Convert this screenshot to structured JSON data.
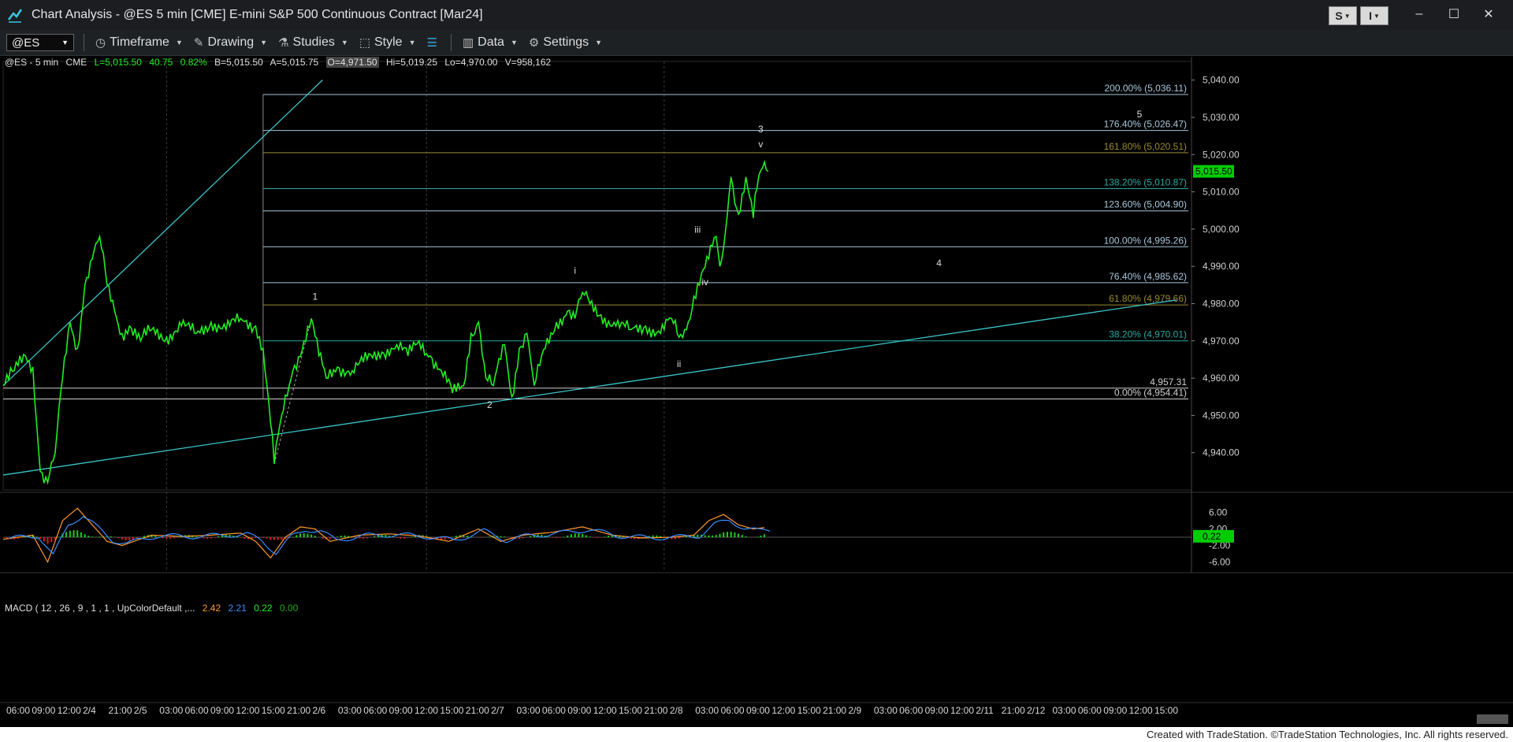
{
  "window": {
    "title": "Chart Analysis - @ES 5 min [CME] E-mini S&P 500 Continuous Contract [Mar24]",
    "s_button": "S",
    "i_button": "I",
    "minimize": "–",
    "maximize": "☐",
    "close": "✕"
  },
  "toolbar": {
    "symbol": "@ES",
    "items": [
      "Timeframe",
      "Drawing",
      "Studies",
      "Style",
      "Data",
      "Settings"
    ]
  },
  "quote": {
    "symbol": "@ES - 5 min",
    "exchange": "CME",
    "last": "L=5,015.50",
    "change": "40.75",
    "pct": "0.82%",
    "bid": "B=5,015.50",
    "ask": "A=5,015.75",
    "open": "O=4,971.50",
    "high": "Hi=5,019.25",
    "low": "Lo=4,970.00",
    "volume": "V=958,162"
  },
  "macd": {
    "label": "MACD ( 12 , 26 , 9 , 1 , 1 , UpColorDefault ,...",
    "v1": "2.42",
    "v2": "2.21",
    "v3": "0.22",
    "v4": "0.00"
  },
  "footer": "Created with TradeStation. ©TradeStation Technologies, Inc. All rights reserved.",
  "colors": {
    "price": "#22ee22",
    "trendline": "#3bc4c8",
    "fib_blue": "#a9c7db",
    "fib_gold": "#9a8a30",
    "fib_teal": "#2aa7a0",
    "macd_up": "#19d019",
    "macd_down": "#e01a1a",
    "last_price_bg": "#00cc00"
  },
  "chart_data": {
    "type": "line",
    "y_range": [
      4930,
      5045
    ],
    "y_ticks": [
      "5,040.00",
      "5,030.00",
      "5,020.00",
      "5,010.00",
      "5,000.00",
      "4,990.00",
      "4,980.00",
      "4,970.00",
      "4,960.00",
      "4,950.00",
      "4,940.00"
    ],
    "y_tick_values": [
      5040,
      5030,
      5020,
      5010,
      5000,
      4990,
      4980,
      4970,
      4960,
      4950,
      4940
    ],
    "last_price_label": "5,015.50",
    "last_price": 5015.5,
    "x_tick_labels": [
      "06:00",
      "09:00",
      "12:00",
      "2/4",
      "21:00",
      "2/5",
      "03:00",
      "06:00",
      "09:00",
      "12:00",
      "15:00",
      "21:00",
      "2/6",
      "03:00",
      "06:00",
      "09:00",
      "12:00",
      "15:00",
      "21:00",
      "2/7",
      "03:00",
      "06:00",
      "09:00",
      "12:00",
      "15:00",
      "21:00",
      "2/8",
      "03:00",
      "06:00",
      "09:00",
      "12:00",
      "15:00",
      "21:00",
      "2/9",
      "03:00",
      "06:00",
      "09:00",
      "12:00",
      "2/11",
      "21:00",
      "2/12",
      "03:00",
      "06:00",
      "09:00",
      "12:00",
      "15:00"
    ],
    "price_series": [
      [
        0,
        4958
      ],
      [
        3,
        4962
      ],
      [
        6,
        4966
      ],
      [
        8,
        4963
      ],
      [
        10,
        4935
      ],
      [
        12,
        4932
      ],
      [
        14,
        4940
      ],
      [
        16,
        4960
      ],
      [
        18,
        4975
      ],
      [
        20,
        4968
      ],
      [
        22,
        4985
      ],
      [
        24,
        4992
      ],
      [
        26,
        4998
      ],
      [
        28,
        4985
      ],
      [
        30,
        4978
      ],
      [
        32,
        4972
      ],
      [
        34,
        4974
      ],
      [
        37,
        4970
      ],
      [
        40,
        4973
      ],
      [
        44,
        4971
      ],
      [
        48,
        4974
      ],
      [
        52,
        4972
      ],
      [
        56,
        4975
      ],
      [
        60,
        4973
      ],
      [
        64,
        4976
      ],
      [
        68,
        4974
      ],
      [
        70,
        4968
      ],
      [
        72,
        4948
      ],
      [
        73,
        4937
      ],
      [
        75,
        4950
      ],
      [
        78,
        4962
      ],
      [
        81,
        4970
      ],
      [
        83,
        4976
      ],
      [
        85,
        4966
      ],
      [
        87,
        4960
      ],
      [
        90,
        4963
      ],
      [
        94,
        4962
      ],
      [
        98,
        4965
      ],
      [
        102,
        4967
      ],
      [
        106,
        4969
      ],
      [
        109,
        4966
      ],
      [
        112,
        4970
      ],
      [
        115,
        4966
      ],
      [
        118,
        4962
      ],
      [
        121,
        4956
      ],
      [
        124,
        4958
      ],
      [
        126,
        4972
      ],
      [
        128,
        4975
      ],
      [
        130,
        4960
      ],
      [
        132,
        4958
      ],
      [
        135,
        4969
      ],
      [
        137,
        4955
      ],
      [
        139,
        4968
      ],
      [
        141,
        4972
      ],
      [
        143,
        4958
      ],
      [
        146,
        4968
      ],
      [
        149,
        4975
      ],
      [
        152,
        4978
      ],
      [
        154,
        4976
      ],
      [
        156,
        4983
      ],
      [
        158,
        4980
      ],
      [
        161,
        4977
      ],
      [
        165,
        4974
      ],
      [
        169,
        4973
      ],
      [
        173,
        4974
      ],
      [
        177,
        4972
      ],
      [
        180,
        4976
      ],
      [
        182,
        4971
      ],
      [
        184,
        4973
      ],
      [
        186,
        4982
      ],
      [
        188,
        4988
      ],
      [
        190,
        4992
      ],
      [
        192,
        4998
      ],
      [
        193,
        4990
      ],
      [
        194,
        4995
      ],
      [
        196,
        5014
      ],
      [
        198,
        5004
      ],
      [
        200,
        5014
      ],
      [
        202,
        5003
      ],
      [
        203,
        5011
      ],
      [
        205,
        5018
      ],
      [
        206,
        5015.5
      ]
    ],
    "macd_series": [
      [
        0,
        -0.5
      ],
      [
        8,
        0.5
      ],
      [
        12,
        -6
      ],
      [
        16,
        4
      ],
      [
        20,
        7
      ],
      [
        24,
        3
      ],
      [
        28,
        -1
      ],
      [
        32,
        -2
      ],
      [
        40,
        0.5
      ],
      [
        48,
        0.2
      ],
      [
        56,
        0.5
      ],
      [
        64,
        1
      ],
      [
        68,
        -1
      ],
      [
        72,
        -5
      ],
      [
        76,
        0
      ],
      [
        80,
        2.5
      ],
      [
        84,
        2
      ],
      [
        88,
        -1
      ],
      [
        96,
        0.5
      ],
      [
        104,
        0.8
      ],
      [
        112,
        0.3
      ],
      [
        120,
        -1
      ],
      [
        128,
        2
      ],
      [
        134,
        -1
      ],
      [
        140,
        0.5
      ],
      [
        148,
        1.2
      ],
      [
        156,
        2.5
      ],
      [
        164,
        0.5
      ],
      [
        172,
        -0.2
      ],
      [
        180,
        0
      ],
      [
        186,
        0.5
      ],
      [
        190,
        4
      ],
      [
        194,
        5.5
      ],
      [
        198,
        3
      ],
      [
        202,
        2
      ],
      [
        206,
        2.42
      ]
    ],
    "macd_range": [
      -8,
      8
    ],
    "macd_ticks": [
      "6.00",
      "2.00",
      "-2.00",
      "-6.00"
    ],
    "macd_tick_values": [
      6,
      2,
      -2,
      -6
    ],
    "macd_last_label": "0.22",
    "macd_last": 0.22,
    "fib_levels": [
      {
        "label": "200.00% (5,036.11)",
        "value": 5036.11,
        "tone": "blue"
      },
      {
        "label": "176.40% (5,026.47)",
        "value": 5026.47,
        "tone": "blue"
      },
      {
        "label": "161.80% (5,020.51)",
        "value": 5020.51,
        "tone": "gold"
      },
      {
        "label": "138.20% (5,010.87)",
        "value": 5010.87,
        "tone": "teal"
      },
      {
        "label": "123.60% (5,004.90)",
        "value": 5004.9,
        "tone": "blue"
      },
      {
        "label": "100.00% (4,995.26)",
        "value": 4995.26,
        "tone": "blue"
      },
      {
        "label": "76.40% (4,985.62)",
        "value": 4985.62,
        "tone": "blue"
      },
      {
        "label": "61.80% (4,979.66)",
        "value": 4979.66,
        "tone": "gold"
      },
      {
        "label": "38.20% (4,970.01)",
        "value": 4970.01,
        "tone": "teal"
      },
      {
        "label": "4,957.31",
        "value": 4957.31,
        "tone": "white"
      },
      {
        "label": "0.00% (4,954.41)",
        "value": 4954.41,
        "tone": "white"
      }
    ],
    "wave_labels": [
      {
        "text": "1",
        "x": 84,
        "y": 4981
      },
      {
        "text": "2",
        "x": 131,
        "y": 4952
      },
      {
        "text": "i",
        "x": 154,
        "y": 4988
      },
      {
        "text": "ii",
        "x": 182,
        "y": 4963
      },
      {
        "text": "iii",
        "x": 187,
        "y": 4999
      },
      {
        "text": "iv",
        "x": 189,
        "y": 4985
      },
      {
        "text": "v",
        "x": 204,
        "y": 5022
      },
      {
        "text": "3",
        "x": 204,
        "y": 5026
      },
      {
        "text": "4",
        "x": 252,
        "y": 4990
      },
      {
        "text": "5",
        "x": 306,
        "y": 5030
      }
    ]
  }
}
